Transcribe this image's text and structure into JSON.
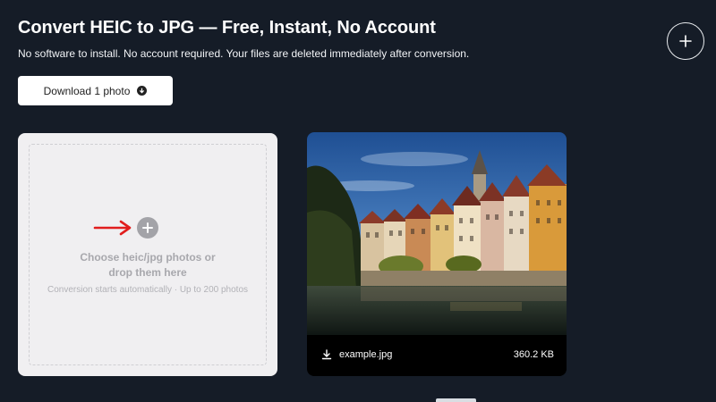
{
  "header": {
    "title": "Convert HEIC to JPG — Free, Instant, No Account",
    "subtitle": "No software to install. No account required. Your files are deleted immediately after conversion."
  },
  "toolbar": {
    "download_label": "Download 1 photo",
    "download_icon": "arrow-down-circle-icon",
    "add_icon": "plus-icon"
  },
  "dropzone": {
    "line1": "Choose heic/jpg photos or",
    "line2": "drop them here",
    "hint": "Conversion starts automatically · Up to 200 photos",
    "arrow_color": "#e11d1d"
  },
  "files": [
    {
      "name": "example.jpg",
      "size": "360.2 KB"
    }
  ],
  "colors": {
    "background": "#151c27",
    "dropzone_bg": "#f0eff1",
    "card_bg": "#000000"
  }
}
